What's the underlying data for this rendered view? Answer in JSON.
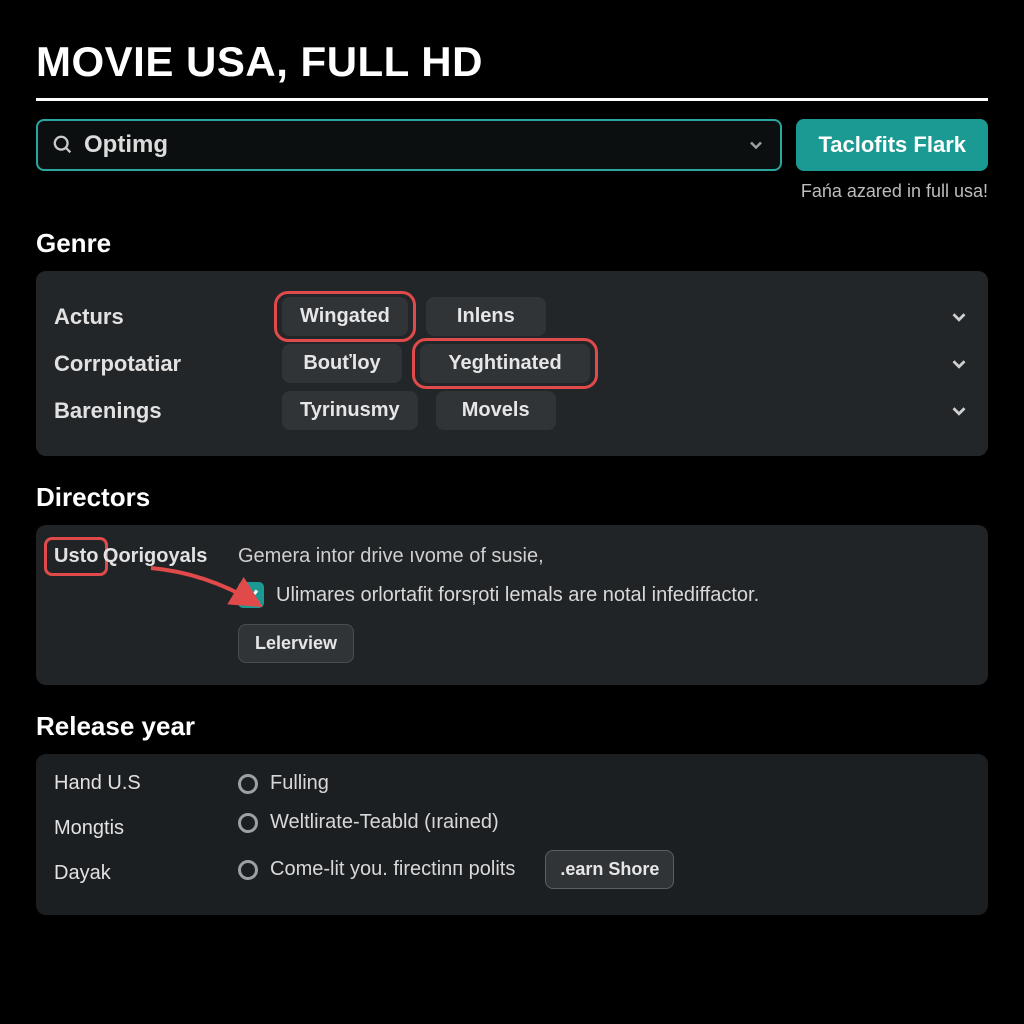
{
  "header": {
    "title": "Movie USA, Full HD"
  },
  "search": {
    "value": "Optimg"
  },
  "cta": {
    "label": "Taclofits Flark"
  },
  "hint": "Fańa azared in full usa!",
  "sections": {
    "genre": {
      "heading": "Genre",
      "rows": [
        {
          "label": "Acturs",
          "chip1": "Wingated",
          "chip2": "Inlens",
          "circled": 1
        },
        {
          "label": "Corrpotatiar",
          "chip1": "Bouťloy",
          "chip2": "Yeghtinated",
          "circled": 2
        },
        {
          "label": "Barenings",
          "chip1": "Tyrinusmy",
          "chip2": "Movels",
          "circled": 0
        }
      ]
    },
    "directors": {
      "heading": "Directors",
      "side": [
        "Usto",
        "Qorigoyals"
      ],
      "line1": "Gemera intor drive ıvome of susie,",
      "checkbox_label": "Ulimares orlortafit forsŗoti lemals are notal infediffactor.",
      "button": "Lelerview"
    },
    "release": {
      "heading": "Release year",
      "side": [
        "Hand U.S",
        "Mongtis",
        "Dayak"
      ],
      "radios": [
        "Fulling",
        "Weltlirate-Teabld (ırained)",
        "Come-lit you. firectinп polits"
      ],
      "learn": ".earn Shore"
    }
  }
}
